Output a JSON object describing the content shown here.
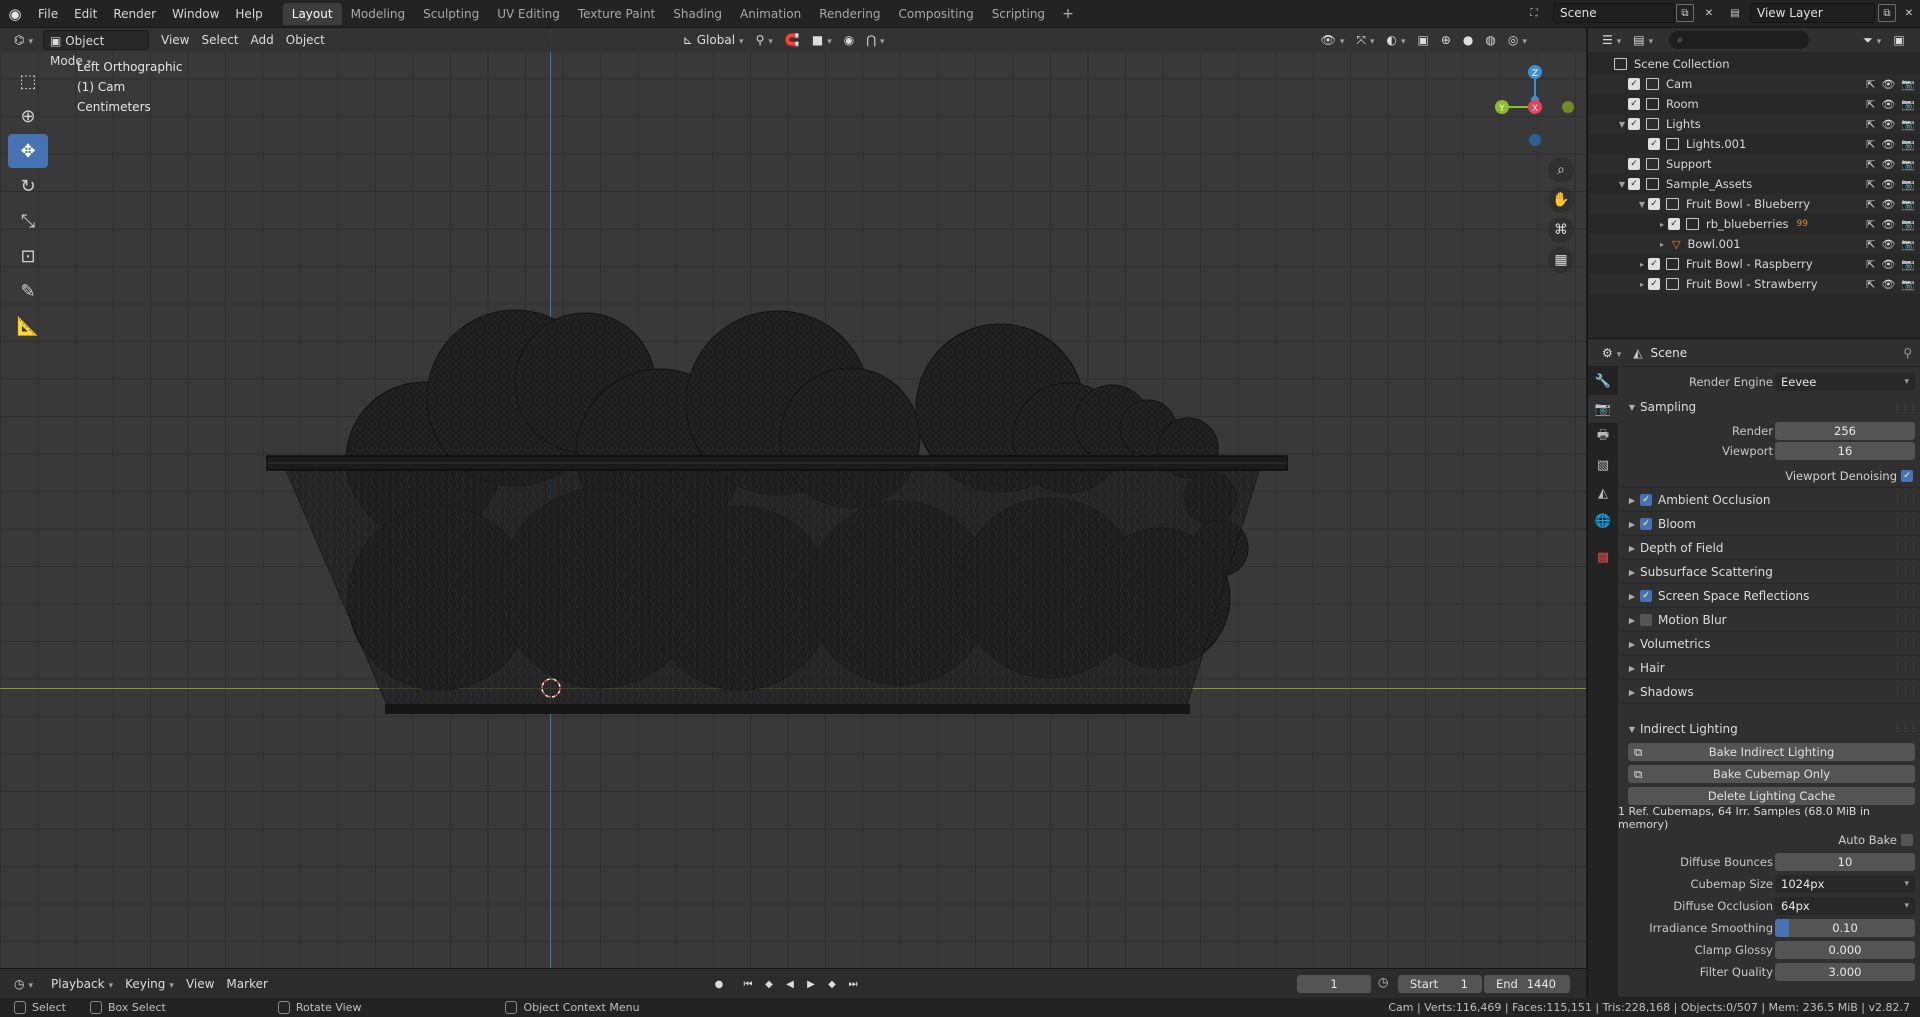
{
  "app": {
    "menus": [
      "File",
      "Edit",
      "Render",
      "Window",
      "Help"
    ],
    "workspaces": [
      "Layout",
      "Modeling",
      "Sculpting",
      "UV Editing",
      "Texture Paint",
      "Shading",
      "Animation",
      "Rendering",
      "Compositing",
      "Scripting"
    ],
    "active_workspace": "Layout",
    "add_workspace": "+",
    "scene_name": "Scene",
    "view_layer": "View Layer"
  },
  "viewport": {
    "mode": "Object Mode",
    "menus": [
      "View",
      "Select",
      "Add",
      "Object"
    ],
    "transform_orientation": "Global",
    "info": [
      "Left Orthographic",
      "(1) Cam",
      "Centimeters"
    ],
    "gizmo": {
      "z": "Z",
      "y": "Y",
      "x": "X"
    },
    "axis_colors": {
      "x": "#e5435a",
      "y": "#8bbd2c",
      "z": "#3f8fd6"
    }
  },
  "outliner": {
    "root": "Scene Collection",
    "items": [
      {
        "label": "Cam"
      },
      {
        "label": "Room"
      },
      {
        "label": "Lights"
      },
      {
        "label": "Lights.001"
      },
      {
        "label": "Support"
      },
      {
        "label": "Sample_Assets"
      },
      {
        "label": "Fruit Bowl - Blueberry"
      },
      {
        "label": "rb_blueberries",
        "badge": "99"
      },
      {
        "label": "Bowl.001"
      },
      {
        "label": "Fruit Bowl - Raspberry"
      },
      {
        "label": "Fruit Bowl - Strawberry"
      }
    ]
  },
  "properties": {
    "context": "Scene",
    "render_engine_label": "Render Engine",
    "render_engine": "Eevee",
    "sampling": {
      "title": "Sampling",
      "render_label": "Render",
      "render": "256",
      "viewport_label": "Viewport",
      "viewport": "16",
      "denoise_label": "Viewport Denoising"
    },
    "panels": [
      {
        "label": "Ambient Occlusion",
        "checkbox": "on"
      },
      {
        "label": "Bloom",
        "checkbox": "on"
      },
      {
        "label": "Depth of Field",
        "checkbox": "none"
      },
      {
        "label": "Subsurface Scattering",
        "checkbox": "none"
      },
      {
        "label": "Screen Space Reflections",
        "checkbox": "on"
      },
      {
        "label": "Motion Blur",
        "checkbox": "off"
      },
      {
        "label": "Volumetrics",
        "checkbox": "none"
      },
      {
        "label": "Hair",
        "checkbox": "none"
      },
      {
        "label": "Shadows",
        "checkbox": "none"
      }
    ],
    "indirect": {
      "title": "Indirect Lighting",
      "bake": "Bake Indirect Lighting",
      "bake_cubemap": "Bake Cubemap Only",
      "delete_cache": "Delete Lighting Cache",
      "info": "1 Ref. Cubemaps, 64 Irr. Samples (68.0 MiB in memory)",
      "auto_bake": "Auto Bake",
      "diffuse_bounces_label": "Diffuse Bounces",
      "diffuse_bounces": "10",
      "cubemap_size_label": "Cubemap Size",
      "cubemap_size": "1024px",
      "diffuse_occlusion_label": "Diffuse Occlusion",
      "diffuse_occlusion": "64px",
      "irradiance_smoothing_label": "Irradiance Smoothing",
      "irradiance_smoothing": "0.10",
      "clamp_glossy_label": "Clamp Glossy",
      "clamp_glossy": "0.000",
      "filter_quality_label": "Filter Quality",
      "filter_quality": "3.000"
    }
  },
  "timeline": {
    "menus": [
      "Playback",
      "Keying",
      "View",
      "Marker"
    ],
    "current_frame": "1",
    "start_label": "Start",
    "start": "1",
    "end_label": "End",
    "end": "1440"
  },
  "statusbar": {
    "select": "Select",
    "box_select": "Box Select",
    "rotate_view": "Rotate View",
    "context_menu": "Object Context Menu",
    "stats": "Cam | Verts:116,469 | Faces:115,151 | Tris:228,168 | Objects:0/507 | Mem: 236.5 MiB | v2.82.7"
  }
}
